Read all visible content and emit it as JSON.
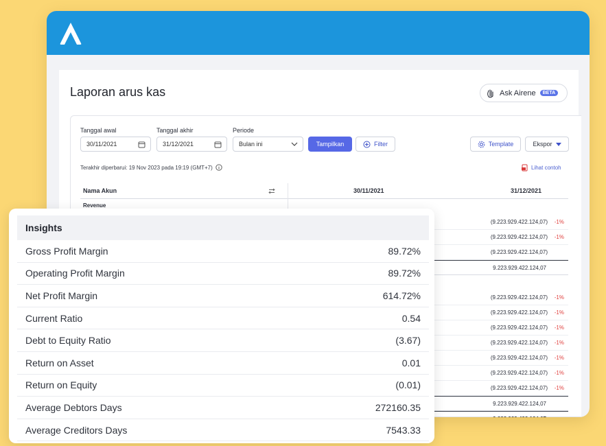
{
  "page": {
    "title": "Laporan arus kas"
  },
  "ask": {
    "label": "Ask Airene",
    "badge": "BETA"
  },
  "filters": {
    "start_label": "Tanggal awal",
    "start_value": "30/11/2021",
    "end_label": "Tanggal akhir",
    "end_value": "31/12/2021",
    "period_label": "Periode",
    "period_value": "Bulan ini"
  },
  "buttons": {
    "show": "Tampilkan",
    "filter": "Filter",
    "template": "Template",
    "export": "Ekspor"
  },
  "meta": {
    "updated": "Terakhir diperbarui: 19 Nov 2023 pada 19:19 (GMT+7)",
    "example": "Lihat contoh"
  },
  "table": {
    "col_name": "Nama Akun",
    "col_date1": "30/11/2021",
    "col_date2": "31/12/2021",
    "section_revenue": "Revenue",
    "rows": [
      {
        "value": "(9.223.929.422.124,07)",
        "pct": "-1%"
      },
      {
        "value": "(9.223.929.422.124,07)",
        "pct": "-1%"
      },
      {
        "value": "(9.223.929.422.124,07)",
        "pct": ""
      },
      {
        "value": "9.223.929.422.124,07",
        "pct": ""
      },
      {
        "value": "(9.223.929.422.124,07)",
        "pct": "-1%"
      },
      {
        "value": "(9.223.929.422.124,07)",
        "pct": "-1%"
      },
      {
        "value": "(9.223.929.422.124,07)",
        "pct": "-1%"
      },
      {
        "value": "(9.223.929.422.124,07)",
        "pct": "-1%"
      },
      {
        "value": "(9.223.929.422.124,07)",
        "pct": "-1%"
      },
      {
        "value": "(9.223.929.422.124,07)",
        "pct": "-1%"
      },
      {
        "value": "(9.223.929.422.124,07)",
        "pct": "-1%"
      },
      {
        "value": "9.223.929.422.124,07",
        "pct": ""
      },
      {
        "value": "9.223.929.422.124,07",
        "pct": ""
      }
    ]
  },
  "insights": {
    "title": "Insights",
    "items": [
      {
        "label": "Gross Profit Margin",
        "value": "89.72%"
      },
      {
        "label": "Operating Profit Margin",
        "value": "89.72%"
      },
      {
        "label": "Net Profit Margin",
        "value": "614.72%"
      },
      {
        "label": "Current Ratio",
        "value": "0.54"
      },
      {
        "label": "Debt to Equity Ratio",
        "value": "(3.67)"
      },
      {
        "label": "Return on Asset",
        "value": "0.01"
      },
      {
        "label": "Return on Equity",
        "value": "(0.01)"
      },
      {
        "label": "Average Debtors Days",
        "value": "272160.35"
      },
      {
        "label": "Average Creditors Days",
        "value": "7543.33"
      }
    ]
  },
  "colors": {
    "topbar": "#1c95dc",
    "accent": "#5668e6",
    "background": "#fbd774",
    "negative": "#e0413f"
  }
}
